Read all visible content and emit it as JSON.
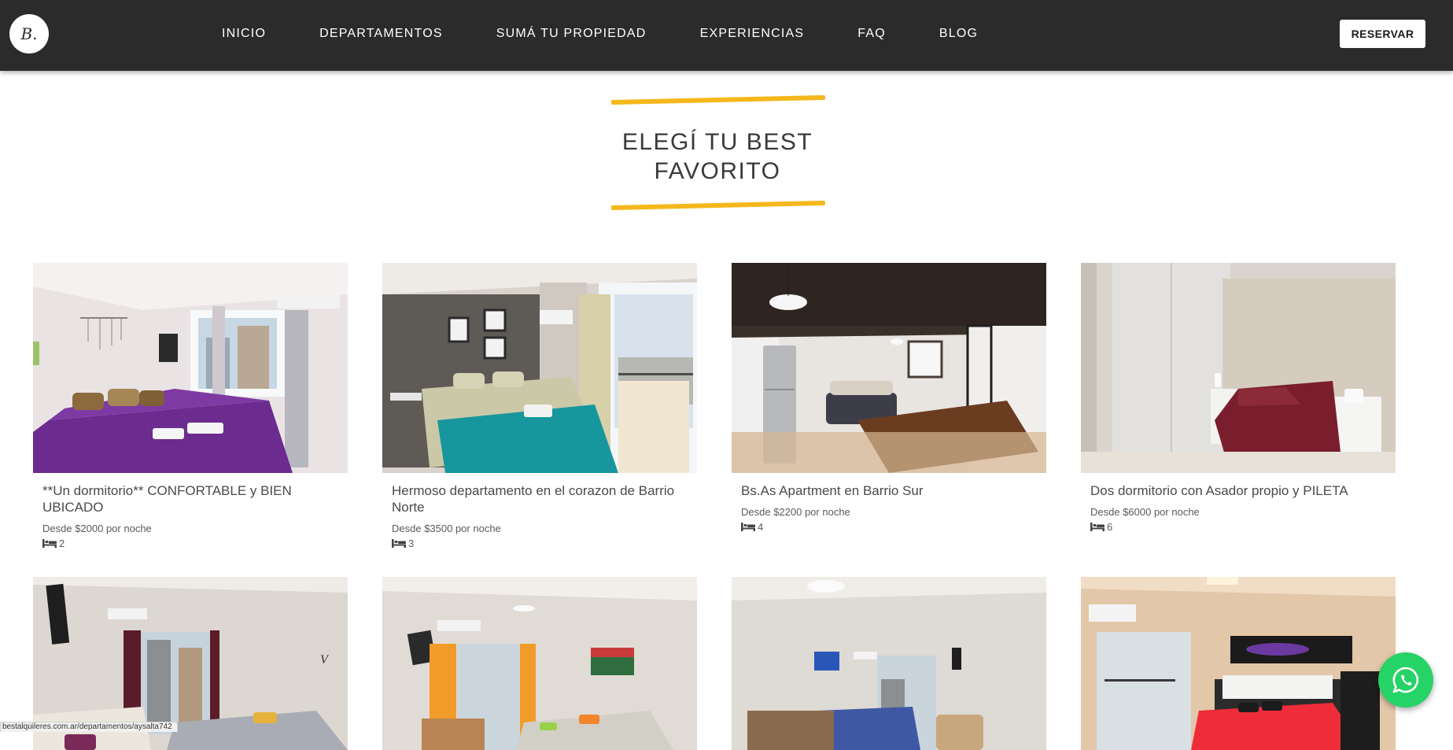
{
  "nav": {
    "logo_text": "B.",
    "items": [
      {
        "label": "INICIO"
      },
      {
        "label": "DEPARTAMENTOS"
      },
      {
        "label": "SUMÁ TU PROPIEDAD"
      },
      {
        "label": "EXPERIENCIAS"
      },
      {
        "label": "FAQ"
      },
      {
        "label": "BLOG"
      }
    ],
    "reserve_label": "RESERVAR"
  },
  "section": {
    "title_line1": "ELEGÍ TU BEST",
    "title_line2": "FAVORITO",
    "accent_color": "#f5b81c"
  },
  "listings": [
    {
      "title": "**Un dormitorio** CONFORTABLE y BIEN UBICADO",
      "price": "Desde $2000 por noche",
      "beds": "2"
    },
    {
      "title": "Hermoso departamento en el corazon de Barrio Norte",
      "price": "Desde $3500 por noche",
      "beds": "3"
    },
    {
      "title": "Bs.As Apartment en Barrio Sur",
      "price": "Desde $2200 por noche",
      "beds": "4"
    },
    {
      "title": "Dos dormitorio con Asador propio y PILETA",
      "price": "Desde $6000 por noche",
      "beds": "6"
    }
  ],
  "status_bar": {
    "url": "bestalquileres.com.ar/departamentos/aysalta742"
  },
  "colors": {
    "navbar": "#2b2b2b",
    "whatsapp": "#25d366"
  }
}
